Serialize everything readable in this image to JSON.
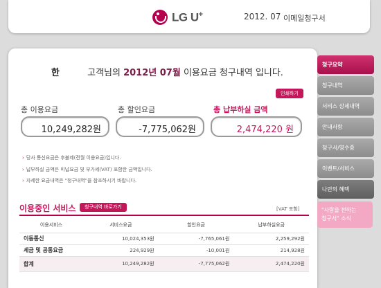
{
  "header": {
    "brand_text": "LG U",
    "brand_plus": "+",
    "date": "2012. 07",
    "doc_title": "이메일청구서"
  },
  "greeting": {
    "name": "한",
    "prefix": "고객님의",
    "year_month": "2012년 07월",
    "suffix": "이용요금 청구내역 입니다."
  },
  "print_button": "인쇄하기",
  "summary": {
    "usage_label": "총 이용요금",
    "usage_value": "10,249,282원",
    "discount_label": "총 할인요금",
    "discount_value": "-7,775,062원",
    "pay_label": "총 납부하실 금액",
    "pay_value": "2,474,220 원"
  },
  "notes": [
    "당사 통신요금은 후불제(전월 이용요금)입니다.",
    "납부하실 금액은 미납요금 및 부가세(VAT) 포함한 금액입니다.",
    "자세한 요금내역은 \"청구내역\"을 참조하시기 바랍니다."
  ],
  "services": {
    "title": "이용중인 서비스",
    "link_button": "청구내역 바로가기",
    "vat_note": "[VAT 포함]",
    "columns": [
      "이용서비스",
      "서비스요금",
      "할인요금",
      "납부하실요금"
    ],
    "rows": [
      {
        "name": "이동통신",
        "service": "10,024,353원",
        "discount": "-7,765,061원",
        "pay": "2,259,292원"
      },
      {
        "name": "세금 및 공통요금",
        "service": "224,929원",
        "discount": "-10,001원",
        "pay": "214,928원"
      }
    ],
    "total": {
      "name": "합계",
      "service": "10,249,282원",
      "discount": "-7,775,062원",
      "pay": "2,474,220원"
    }
  },
  "sidebar": {
    "items": [
      {
        "label": "청구요약"
      },
      {
        "label": "청구내역"
      },
      {
        "label": "서비스 상세내역"
      },
      {
        "label": "안내사항"
      },
      {
        "label": "청구서/영수증"
      },
      {
        "label": "이벤트/서비스"
      },
      {
        "label": "나만의 혜택"
      }
    ],
    "promo_line1": "\"사랑을 전하는",
    "promo_line2": "청구서\" 소식"
  },
  "colors": {
    "accent": "#c2185b",
    "sidebar_gray": "#999999",
    "background": "#dcdcdc"
  }
}
